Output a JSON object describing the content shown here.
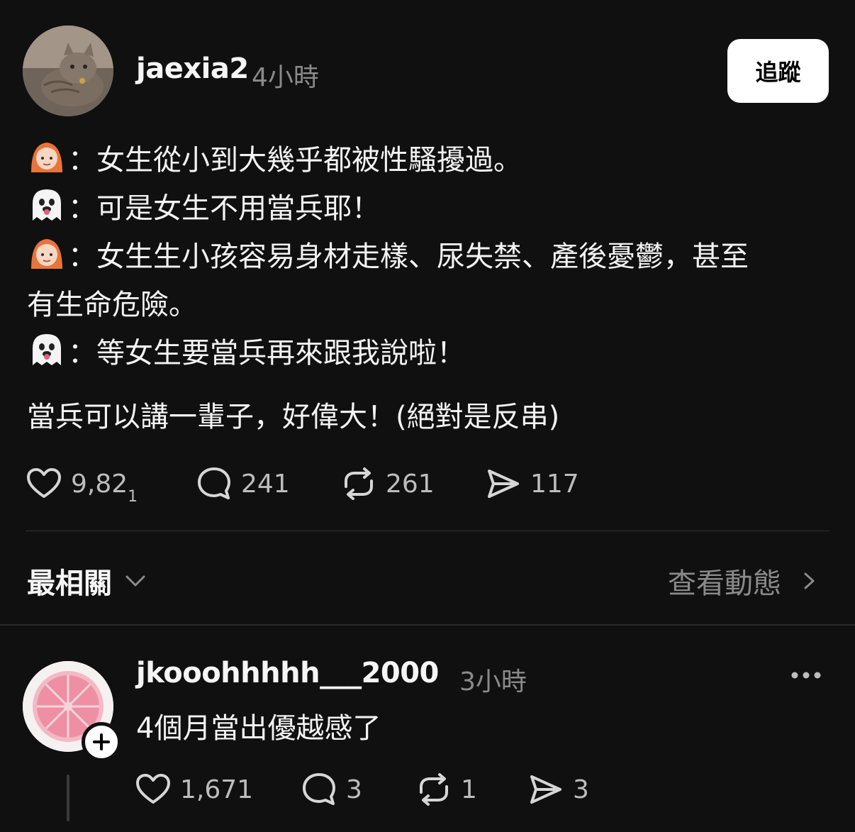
{
  "post": {
    "username": "jaexia2",
    "time": "4小時",
    "follow_label": "追蹤",
    "lines": [
      {
        "emoji": "woman-red-hair-icon",
        "text": "：女生從小到大幾乎都被性騷擾過。"
      },
      {
        "emoji": "ghost-icon",
        "text": "：可是女生不用當兵耶！"
      },
      {
        "emoji": "woman-red-hair-icon",
        "text": "：女生生小孩容易身材走樣、尿失禁、產後憂鬱，甚至"
      },
      {
        "emoji": "",
        "text": "有生命危險。"
      },
      {
        "emoji": "ghost-icon",
        "text": "：等女生要當兵再來跟我說啦！"
      }
    ],
    "closing": "當兵可以講一輩子，好偉大！(絕對是反串)",
    "likes": "9,82",
    "likes_tail": "1",
    "comments": "241",
    "reposts": "261",
    "shares": "117"
  },
  "sort": {
    "label": "最相關",
    "activity_label": "查看動態"
  },
  "comment": {
    "username": "jkooohhhhh___2000",
    "time": "3小時",
    "text": "4個月當出優越感了",
    "likes": "1,671",
    "comments": "3",
    "reposts": "1",
    "shares": "3"
  },
  "icons": {
    "like": "heart-icon",
    "comment": "comment-bubble-icon",
    "repost": "repost-icon",
    "share": "send-icon",
    "more": "more-dots-icon",
    "add": "plus-icon"
  },
  "colors": {
    "background": "#101010",
    "text": "#f3f3f3",
    "muted": "#8a8a8a",
    "follow_bg": "#ffffff"
  }
}
